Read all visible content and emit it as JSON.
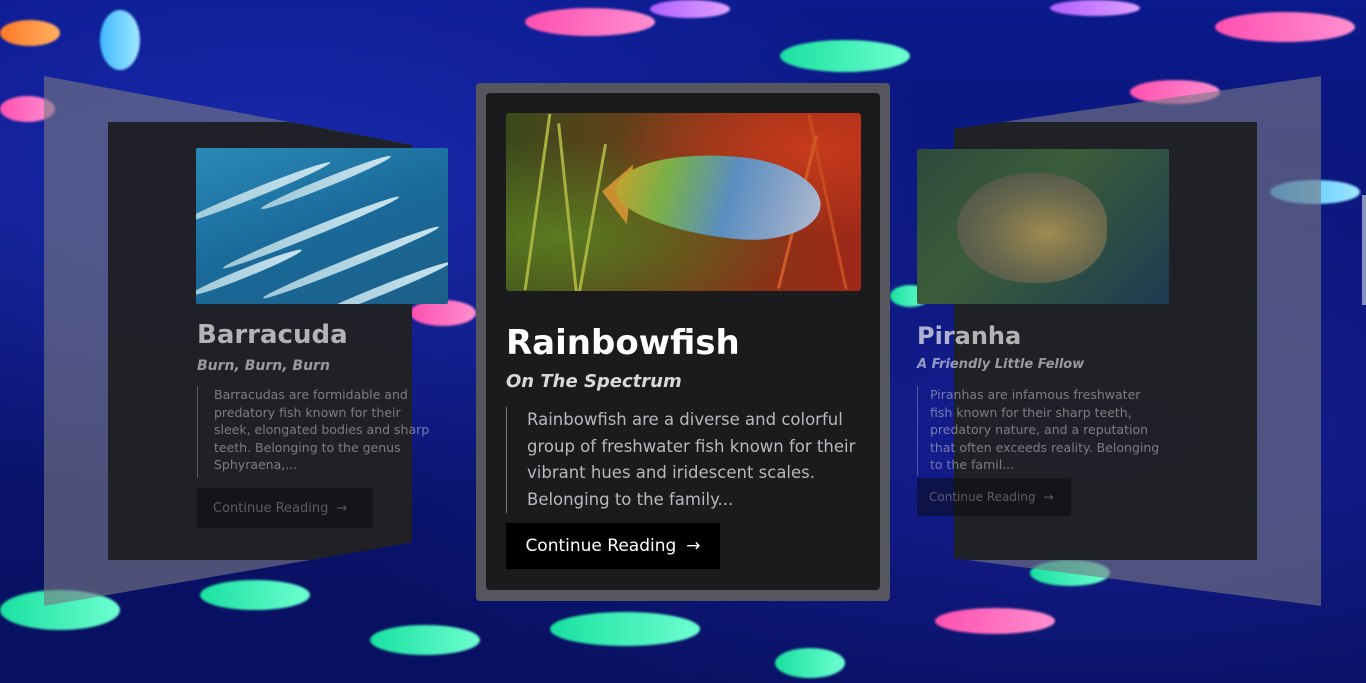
{
  "carousel": {
    "cards": [
      {
        "title": "Barracuda",
        "subtitle": "Burn, Burn, Burn",
        "excerpt": "Barracudas are formidable and predatory fish known for their sleek, elongated bodies and sharp teeth. Belonging to the genus Sphyraena,...",
        "button_label": "Continue Reading",
        "button_icon": "arrow-right-icon"
      },
      {
        "title": "Rainbowfish",
        "subtitle": "On The Spectrum",
        "excerpt": "Rainbowfish are a diverse and colorful group of freshwater fish known for their vibrant hues and iridescent scales. Belonging to the family...",
        "button_label": "Continue Reading",
        "button_icon": "arrow-right-icon"
      },
      {
        "title": "Piranha",
        "subtitle": "A Friendly Little Fellow",
        "excerpt": "Piranhas are infamous freshwater fish known for their sharp teeth, predatory nature, and a reputation that often exceeds reality. Belonging to the famil...",
        "button_label": "Continue Reading",
        "button_icon": "arrow-right-icon"
      }
    ],
    "active_index": 1
  },
  "colors": {
    "background": "#0a1470",
    "card_outer": "#56565f",
    "card_inner": "#1b1b1e",
    "button_bg": "#000000",
    "button_text": "#ffffff"
  }
}
